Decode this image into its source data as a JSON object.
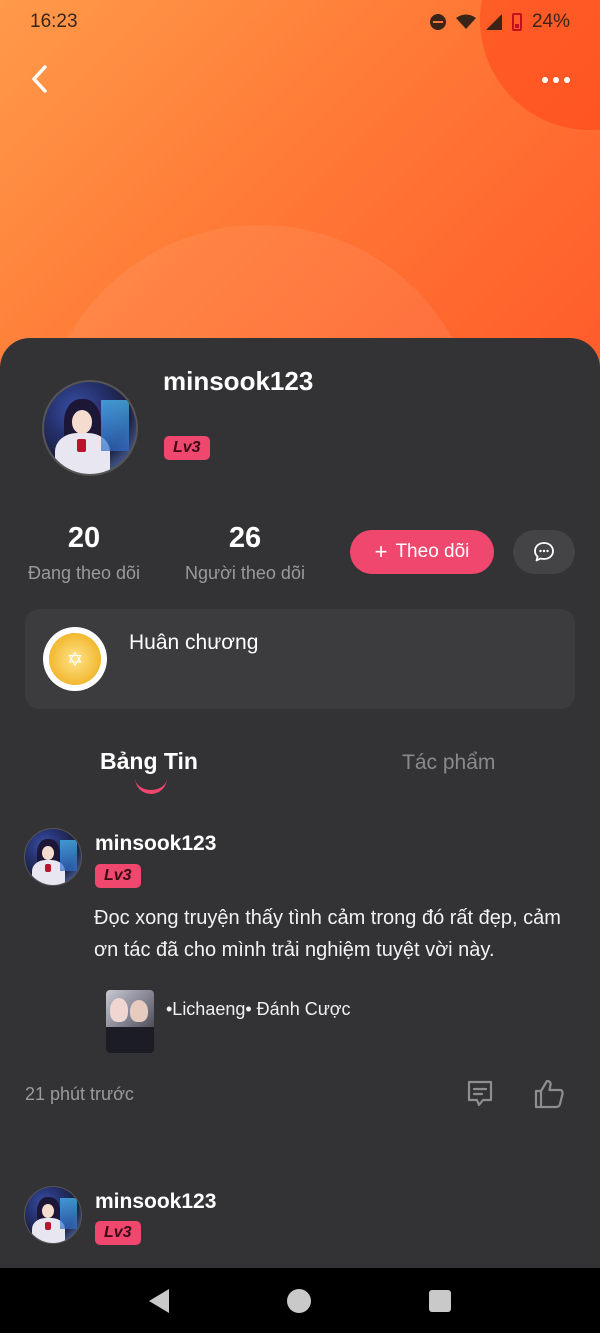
{
  "status_bar": {
    "time": "16:23",
    "battery": "24%"
  },
  "profile": {
    "username": "minsook123",
    "level": "Lv3",
    "following_count": "20",
    "following_label": "Đang theo dõi",
    "followers_count": "26",
    "followers_label": "Người theo dõi",
    "follow_button": "Theo dõi",
    "medal_label": "Huân chương"
  },
  "tabs": [
    {
      "label": "Bảng Tin",
      "active": true
    },
    {
      "label": "Tác phẩm",
      "active": false
    }
  ],
  "posts": [
    {
      "username": "minsook123",
      "level": "Lv3",
      "text": "Đọc xong truyện thấy tình cảm trong đó rất đẹp, cảm ơn tác đã cho mình trải nghiệm tuyệt vời này.",
      "book_title": "•Lichaeng• Đánh Cược",
      "time": "21 phút trước"
    },
    {
      "username": "minsook123",
      "level": "Lv3"
    }
  ],
  "colors": {
    "accent": "#f0476e",
    "background": "#333335",
    "header_gradient_start": "#ff9a4a",
    "header_gradient_end": "#ff5a2a"
  }
}
